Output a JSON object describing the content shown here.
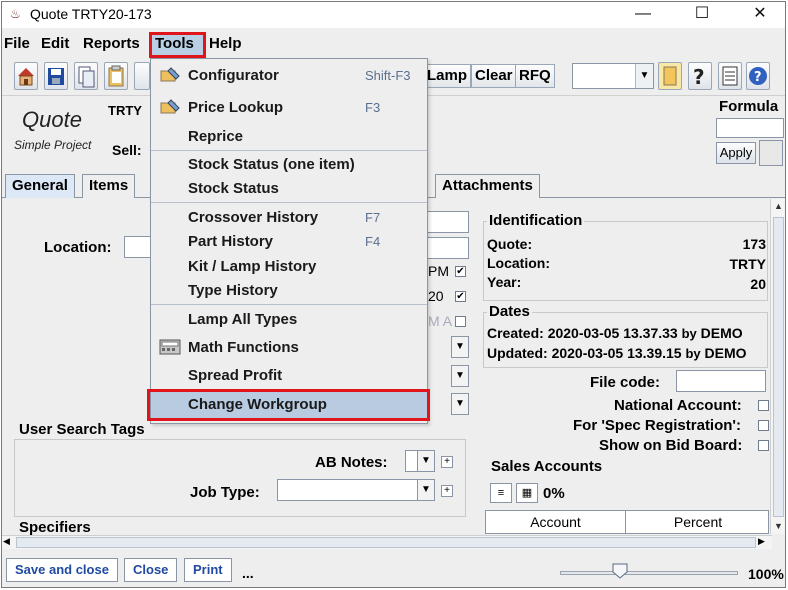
{
  "window": {
    "title": "Quote TRTY20-173",
    "minimize": "—",
    "maximize": "☐",
    "close": "✕"
  },
  "menubar": {
    "items": [
      "File",
      "Edit",
      "Reports",
      "Tools",
      "Help"
    ]
  },
  "toolbar": {
    "lamp": "Lamp",
    "clear": "Clear",
    "rfq": "RFQ",
    "combo_value": ""
  },
  "header": {
    "title": "Quote",
    "subtitle": "Simple Project",
    "code_prefix": "TRTY",
    "sell_label": "Sell:",
    "formula_label": "Formula",
    "apply_label": "Apply"
  },
  "tabs": [
    "General",
    "Items",
    "Attachments"
  ],
  "general": {
    "location_label": "Location:",
    "pm_text": "PM",
    "date_suffix": "20",
    "am_text": "M A",
    "user_search_tags": "User Search Tags",
    "ab_notes_label": "AB Notes:",
    "job_type_label": "Job Type:",
    "specifiers": "Specifiers"
  },
  "identification": {
    "title": "Identification",
    "rows": [
      {
        "label": "Quote:",
        "value": "173"
      },
      {
        "label": "Location:",
        "value": "TRTY"
      },
      {
        "label": "Year:",
        "value": "20"
      }
    ]
  },
  "dates": {
    "title": "Dates",
    "created_label": "Created:",
    "created_value": "2020-03-05 13.37.33",
    "created_by": "by",
    "created_user": "DEMO",
    "updated_label": "Updated:",
    "updated_value": "2020-03-05 13.39.15",
    "updated_by": "by",
    "updated_user": "DEMO"
  },
  "flags": {
    "file_code": "File code:",
    "national_account": "National Account:",
    "spec_registration": "For 'Spec Registration':",
    "bid_board": "Show on Bid Board:"
  },
  "sales_accounts": {
    "title": "Sales Accounts",
    "percent_total": "0%",
    "col_account": "Account",
    "col_percent": "Percent"
  },
  "tools_menu": {
    "items": [
      {
        "label": "Configurator",
        "shortcut": "Shift-F3"
      },
      {
        "label": "Price Lookup",
        "shortcut": "F3"
      },
      {
        "label": "Reprice",
        "shortcut": ""
      },
      {
        "label": "Stock Status (one item)",
        "shortcut": ""
      },
      {
        "label": "Stock Status",
        "shortcut": ""
      },
      {
        "label": "Crossover History",
        "shortcut": "F7"
      },
      {
        "label": "Part History",
        "shortcut": "F4"
      },
      {
        "label": "Kit / Lamp History",
        "shortcut": ""
      },
      {
        "label": "Type History",
        "shortcut": ""
      },
      {
        "label": "Lamp All Types",
        "shortcut": ""
      },
      {
        "label": "Math Functions",
        "shortcut": ""
      },
      {
        "label": "Spread Profit",
        "shortcut": ""
      },
      {
        "label": "Change Workgroup",
        "shortcut": ""
      }
    ]
  },
  "bottom": {
    "save_close": "Save and close",
    "close": "Close",
    "print": "Print",
    "more": "...",
    "zoom": "100%"
  },
  "colors": {
    "highlight_red": "#e0141b",
    "menu_selected": "#b9cbe0",
    "link_blue": "#1f4aa0"
  }
}
